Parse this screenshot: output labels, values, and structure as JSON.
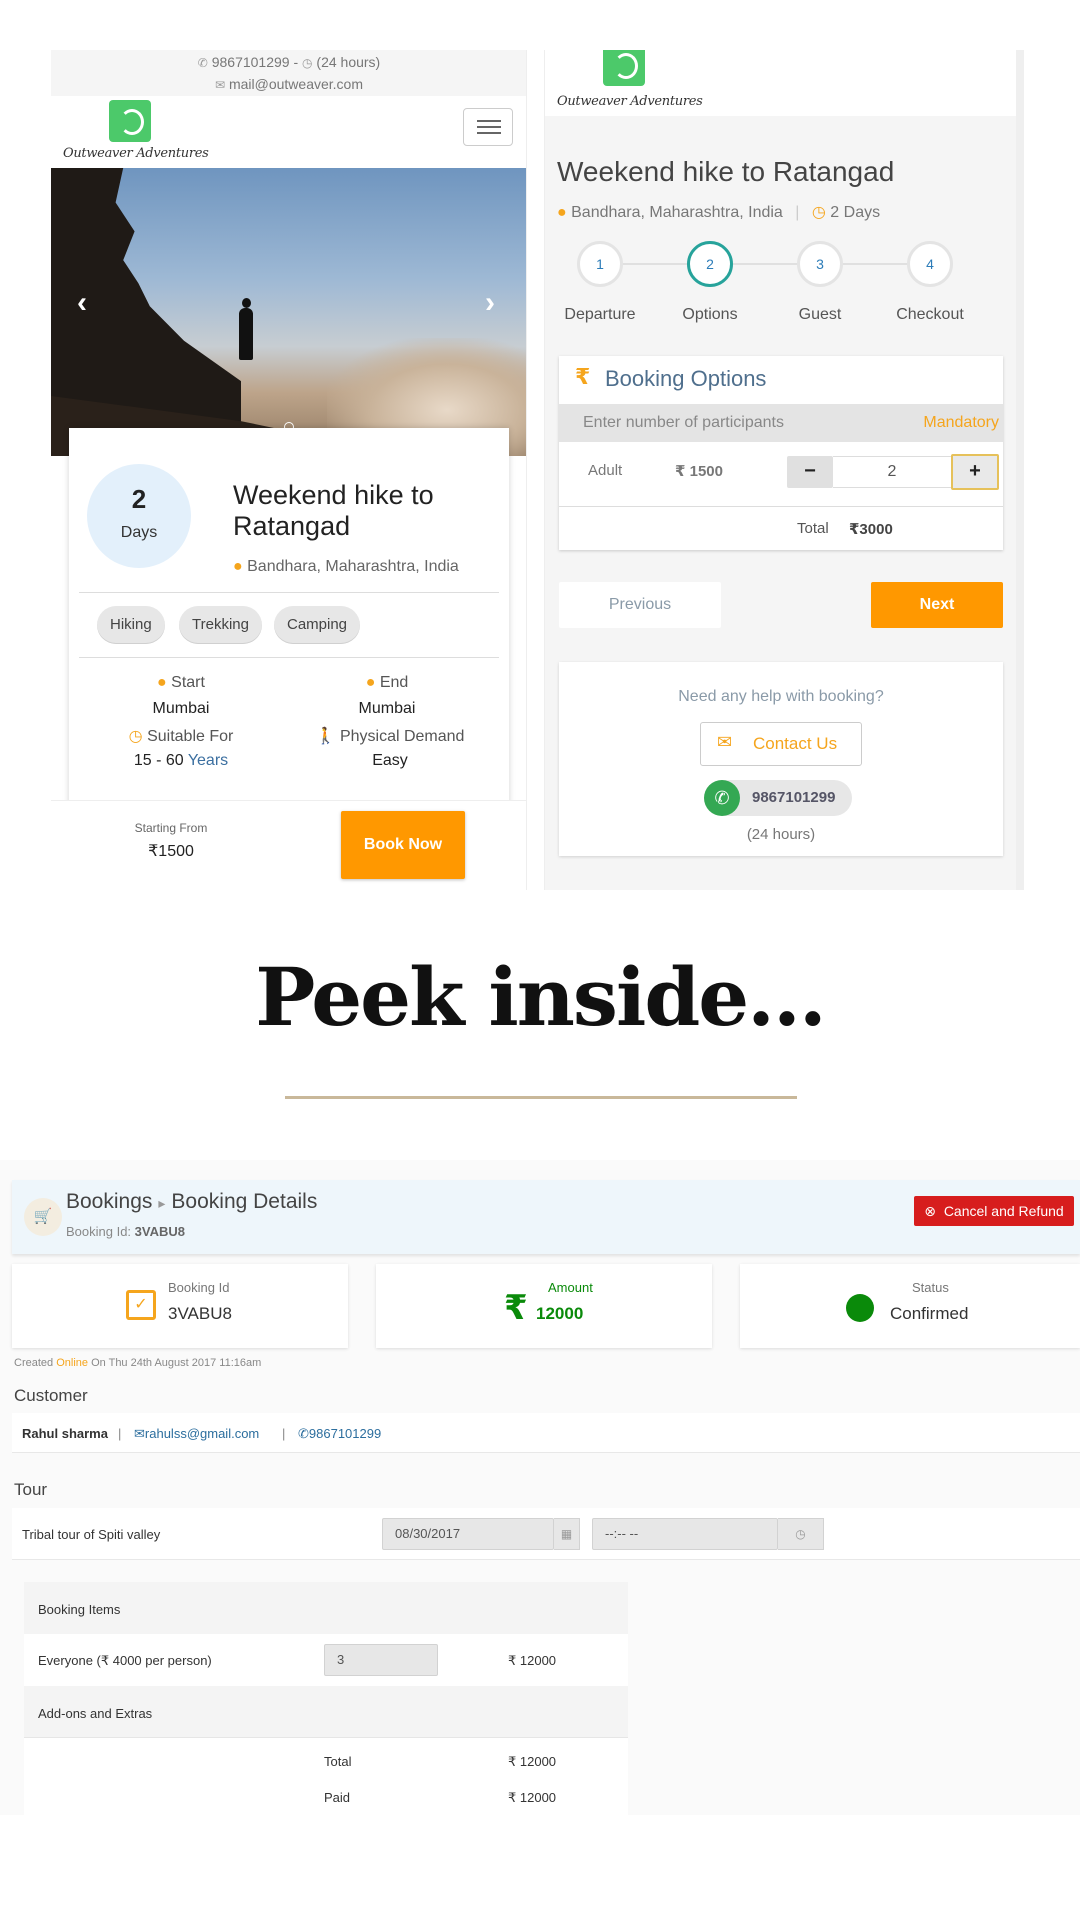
{
  "left_phone": {
    "topbar": {
      "phone_line": "9867101299 - ",
      "hours": "(24 hours)",
      "email": "mail@outweaver.com"
    },
    "logo_text": "Outweaver Adventures",
    "trip": {
      "days_num": "2",
      "days_label": "Days",
      "title": "Weekend hike to Ratangad",
      "location": "Bandhara, Maharashtra, India",
      "tags": [
        "Hiking",
        "Trekking",
        "Camping"
      ],
      "start_label": "Start",
      "start_value": "Mumbai",
      "end_label": "End",
      "end_value": "Mumbai",
      "suitable_label": "Suitable For",
      "suitable_value": "15 - 60",
      "suitable_unit": "Years",
      "demand_label": "Physical Demand",
      "demand_value": "Easy"
    },
    "footer": {
      "starting_from": "Starting From",
      "price": "₹1500",
      "book_now": "Book Now"
    }
  },
  "right_phone": {
    "logo_text": "Outweaver Adventures",
    "title": "Weekend hike to Ratangad",
    "location": "Bandhara, Maharashtra, India",
    "duration": "2 Days",
    "steps": [
      {
        "num": "1",
        "label": "Departure"
      },
      {
        "num": "2",
        "label": "Options"
      },
      {
        "num": "3",
        "label": "Guest"
      },
      {
        "num": "4",
        "label": "Checkout"
      }
    ],
    "booking_options": {
      "title": "Booking Options",
      "participants_prompt": "Enter number of participants",
      "mandatory": "Mandatory",
      "adult_label": "Adult",
      "adult_price": "₹ 1500",
      "quantity": "2",
      "total_label": "Total",
      "total_value": "₹3000"
    },
    "previous": "Previous",
    "next": "Next",
    "help": {
      "question": "Need any help with booking?",
      "contact_us": "Contact Us",
      "phone": "9867101299",
      "hours": "(24 hours)"
    }
  },
  "heading": "Peek inside...",
  "admin": {
    "breadcrumb_root": "Bookings",
    "breadcrumb_current": "Booking Details",
    "booking_id_label": "Booking Id:",
    "booking_id": "3VABU8",
    "cancel_refund": "Cancel and Refund",
    "stats": {
      "booking_id_label": "Booking Id",
      "booking_id_value": "3VABU8",
      "amount_label": "Amount",
      "amount_value": "12000",
      "status_label": "Status",
      "status_value": "Confirmed"
    },
    "created_prefix": "Created",
    "created_channel": "Online",
    "created_suffix": "On Thu 24th August 2017 11:16am",
    "customer_title": "Customer",
    "customer": {
      "name": "Rahul sharma",
      "email": "rahulss@gmail.com",
      "phone": "9867101299"
    },
    "tour_title": "Tour",
    "tour_name": "Tribal tour of Spiti valley",
    "tour_date": "08/30/2017",
    "tour_time": "--:-- --",
    "booking_items_title": "Booking Items",
    "item_label": "Everyone (₹ 4000 per person)",
    "item_qty": "3",
    "item_amount": "₹ 12000",
    "addons_title": "Add-ons and Extras",
    "total_label": "Total",
    "total_value": "₹ 12000",
    "paid_label": "Paid",
    "paid_value": "₹ 12000"
  },
  "colors": {
    "accent": "#ff9800",
    "pin": "#f5a51d",
    "status_green": "#0a8a0a",
    "cancel_red": "#d71d1d",
    "logo_green": "#4cc96a"
  }
}
